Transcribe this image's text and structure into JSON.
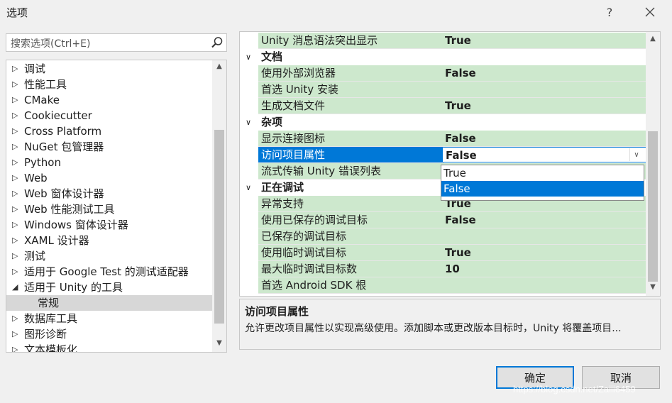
{
  "window": {
    "title": "选项",
    "help_glyph": "?"
  },
  "search": {
    "placeholder": "搜索选项(Ctrl+E)"
  },
  "tree": {
    "items": [
      {
        "label": "调试"
      },
      {
        "label": "性能工具"
      },
      {
        "label": "CMake"
      },
      {
        "label": "Cookiecutter"
      },
      {
        "label": "Cross Platform"
      },
      {
        "label": "NuGet 包管理器"
      },
      {
        "label": "Python"
      },
      {
        "label": "Web"
      },
      {
        "label": "Web 窗体设计器"
      },
      {
        "label": "Web 性能测试工具"
      },
      {
        "label": "Windows 窗体设计器"
      },
      {
        "label": "XAML 设计器"
      },
      {
        "label": "测试"
      },
      {
        "label": "适用于 Google Test 的测试适配器"
      },
      {
        "label": "适用于 Unity 的工具"
      },
      {
        "label": "常规"
      },
      {
        "label": "数据库工具"
      },
      {
        "label": "图形诊断"
      },
      {
        "label": "文本模板化"
      }
    ]
  },
  "grid": {
    "rows": [
      {
        "name": "Unity 消息语法突出显示",
        "value": "True"
      },
      {
        "category": "文档"
      },
      {
        "name": "使用外部浏览器",
        "value": "False"
      },
      {
        "name": "首选 Unity 安装",
        "value": ""
      },
      {
        "name": "生成文档文件",
        "value": "True"
      },
      {
        "category": "杂项"
      },
      {
        "name": "显示连接图标",
        "value": "False"
      },
      {
        "name": "访问项目属性",
        "value": "False"
      },
      {
        "name": "流式传输 Unity 错误列表",
        "value": ""
      },
      {
        "category": "正在调试"
      },
      {
        "name": "异常支持",
        "value": "True"
      },
      {
        "name": "使用已保存的调试目标",
        "value": "False"
      },
      {
        "name": "已保存的调试目标",
        "value": ""
      },
      {
        "name": "使用临时调试目标",
        "value": "True"
      },
      {
        "name": "最大临时调试目标数",
        "value": "10"
      },
      {
        "name": "首选 Android SDK 根",
        "value": ""
      }
    ]
  },
  "dropdown": {
    "options": [
      "True",
      "False"
    ],
    "highlighted": "False"
  },
  "description": {
    "title": "访问项目属性",
    "text": "允许更改项目属性以实现高级使用。添加脚本或更改版本目标时，Unity 将覆盖项目..."
  },
  "buttons": {
    "ok": "确定",
    "cancel": "取消"
  },
  "watermark": "https://blog.csdn.net/Zaiii6459",
  "colors": {
    "accent": "#0078d7",
    "row_bg": "#cde8cd",
    "selected_tree": "#d7d7d7"
  }
}
